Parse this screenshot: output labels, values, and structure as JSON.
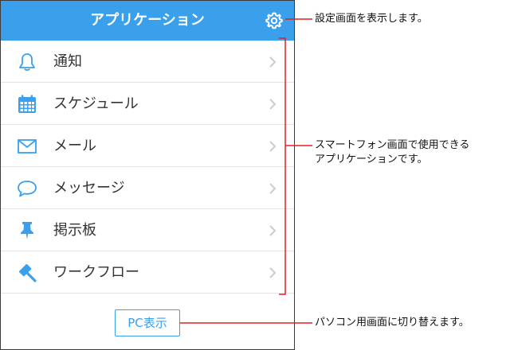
{
  "header": {
    "title": "アプリケーション"
  },
  "menu": [
    {
      "label": "通知",
      "icon": "bell-icon"
    },
    {
      "label": "スケジュール",
      "icon": "calendar-icon"
    },
    {
      "label": "メール",
      "icon": "envelope-icon"
    },
    {
      "label": "メッセージ",
      "icon": "speech-bubble-icon"
    },
    {
      "label": "掲示板",
      "icon": "pushpin-icon"
    },
    {
      "label": "ワークフロー",
      "icon": "gavel-icon"
    }
  ],
  "pc_button": {
    "label": "PC表示"
  },
  "annotations": {
    "settings": "設定画面を表示します。",
    "apps_line1": "スマートフォン画面で使用できる",
    "apps_line2": "アプリケーションです。",
    "pc": "パソコン用画面に切り替えます。"
  },
  "colors": {
    "accent": "#3aa0ec",
    "annotation_line": "#e02020",
    "chevron": "#cccccc"
  }
}
